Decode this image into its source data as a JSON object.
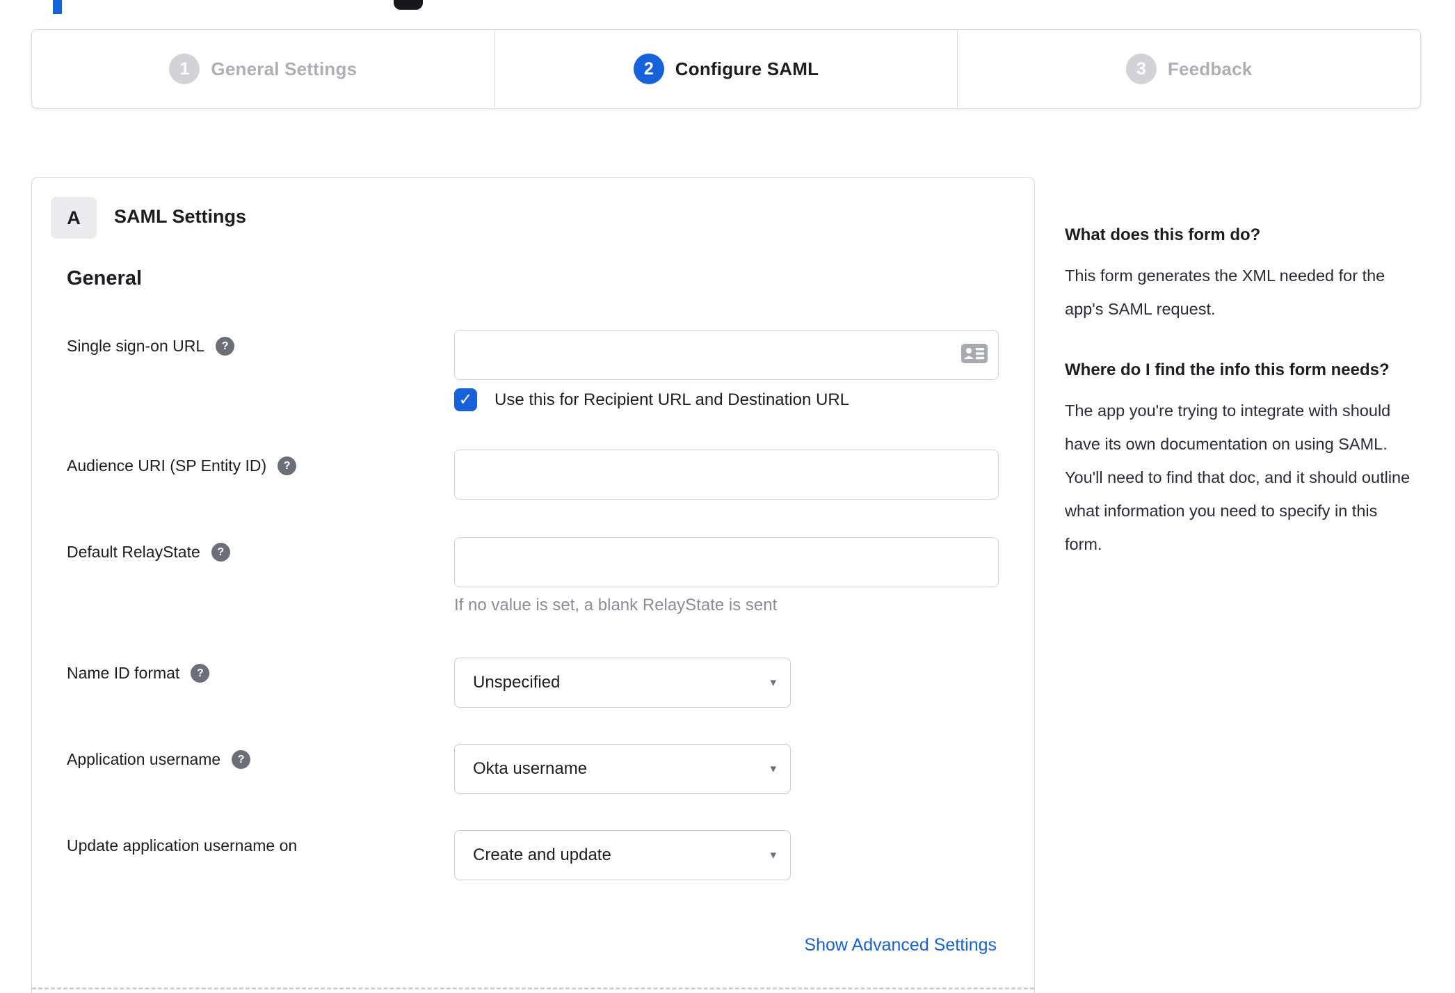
{
  "colors": {
    "accent_blue": "#1662dd",
    "border_gray": "#d7d7dc",
    "inactive_gray": "#aeaeb4",
    "text_dark": "#1d1d21",
    "hint_gray": "#8c8c96",
    "help_icon_gray": "#6e6e78"
  },
  "stepper": {
    "steps": [
      {
        "number": "1",
        "label": "General Settings",
        "state": "inactive"
      },
      {
        "number": "2",
        "label": "Configure SAML",
        "state": "active"
      },
      {
        "number": "3",
        "label": "Feedback",
        "state": "inactive"
      }
    ]
  },
  "panel": {
    "section_badge": "A",
    "section_title": "SAML Settings",
    "group_title": "General",
    "fields": [
      {
        "label": "Single sign-on URL",
        "help_icon": "question-mark",
        "control": "input",
        "value": "",
        "input_icon": "contact-card-icon",
        "checkbox_checked": true,
        "checkbox_label": "Use this for Recipient URL and Destination URL"
      },
      {
        "label": "Audience URI (SP Entity ID)",
        "help_icon": "question-mark",
        "control": "input",
        "value": ""
      },
      {
        "label": "Default RelayState",
        "help_icon": "question-mark",
        "control": "input",
        "value": "",
        "hint": "If no value is set, a blank RelayState is sent"
      },
      {
        "label": "Name ID format",
        "help_icon": "question-mark",
        "control": "select",
        "value": "Unspecified"
      },
      {
        "label": "Application username",
        "help_icon": "question-mark",
        "control": "select",
        "value": "Okta username"
      },
      {
        "label": "Update application username on",
        "control": "select",
        "value": "Create and update"
      }
    ],
    "advanced_link": "Show Advanced Settings",
    "help_glyph": "?",
    "check_glyph": "✓",
    "caret_glyph": "▾"
  },
  "sidebar": {
    "heading1": "What does this form do?",
    "paragraph1": "This form generates the XML needed for the app's SAML request.",
    "heading2": "Where do I find the info this form needs?",
    "paragraph2": "The app you're trying to integrate with should have its own documentation on using SAML. You'll need to find that doc, and it should outline what information you need to specify in this form."
  }
}
